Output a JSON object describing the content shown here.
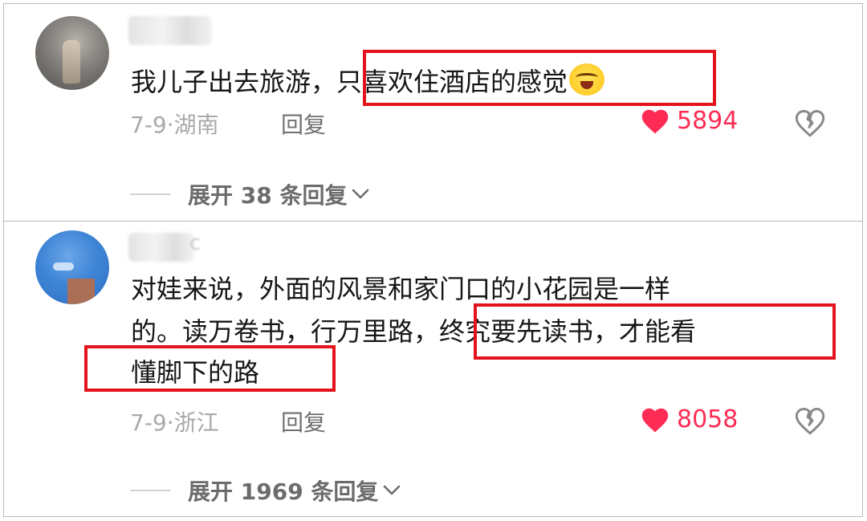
{
  "comments": [
    {
      "text_before": "我儿子出去旅游，",
      "text_highlight": "只喜欢住酒店的感觉",
      "emoji": "crying-laughing-emoji",
      "date": "7-9",
      "location": "湖南",
      "reply_label": "回复",
      "likes": "5894",
      "expand_label": "展开 38 条回复"
    },
    {
      "line1": "对娃来说，外面的风景和家门口的小花园是一样",
      "line2_before": "的。读万卷书，行万里路，",
      "line2_highlight": "终究要先读书，才能看",
      "line3": "懂脚下的路",
      "username_suffix": "c",
      "date": "7-9",
      "location": "浙江",
      "reply_label": "回复",
      "likes": "8058",
      "expand_label": "展开 1969 条回复"
    }
  ],
  "colors": {
    "highlight_box": "#e3131b",
    "like": "#fe2c55",
    "meta": "#a9a9a9"
  }
}
